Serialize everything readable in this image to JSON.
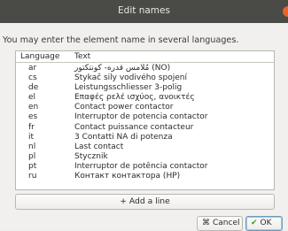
{
  "window": {
    "title": "Edit names"
  },
  "intro": "You may enter the element name in several languages.",
  "table": {
    "headers": {
      "language": "Language",
      "text": "Text"
    },
    "rows": [
      {
        "lang": "ar",
        "text": "مُلامس قدره- كونتكتور (NO)"
      },
      {
        "lang": "cs",
        "text": "Stykač sily vodivého spojení"
      },
      {
        "lang": "de",
        "text": "Leistungsschliesser 3-polig"
      },
      {
        "lang": "el",
        "text": "Επαφές ρελέ ισχύος, ανοικτές"
      },
      {
        "lang": "en",
        "text": "Contact power contactor"
      },
      {
        "lang": "es",
        "text": "Interruptor de potencia contactor"
      },
      {
        "lang": "fr",
        "text": "Contact puissance contacteur"
      },
      {
        "lang": "it",
        "text": "3 Contatti NA di potenza"
      },
      {
        "lang": "nl",
        "text": "Last contact"
      },
      {
        "lang": "pl",
        "text": "Stycznik"
      },
      {
        "lang": "pt",
        "text": "Interruptor de potência contactor"
      },
      {
        "lang": "ru",
        "text": "Контакт контактора (НР)"
      }
    ]
  },
  "buttons": {
    "add_line": "+ Add a line",
    "cancel": "Cancel",
    "ok": "OK"
  },
  "icons": {
    "close": "close-icon",
    "cancel": "cancel-icon",
    "ok": "checkmark-icon"
  },
  "colors": {
    "titlebar": "#4a4a46",
    "close": "#e9632d",
    "ok_border": "#6e9cbc"
  }
}
